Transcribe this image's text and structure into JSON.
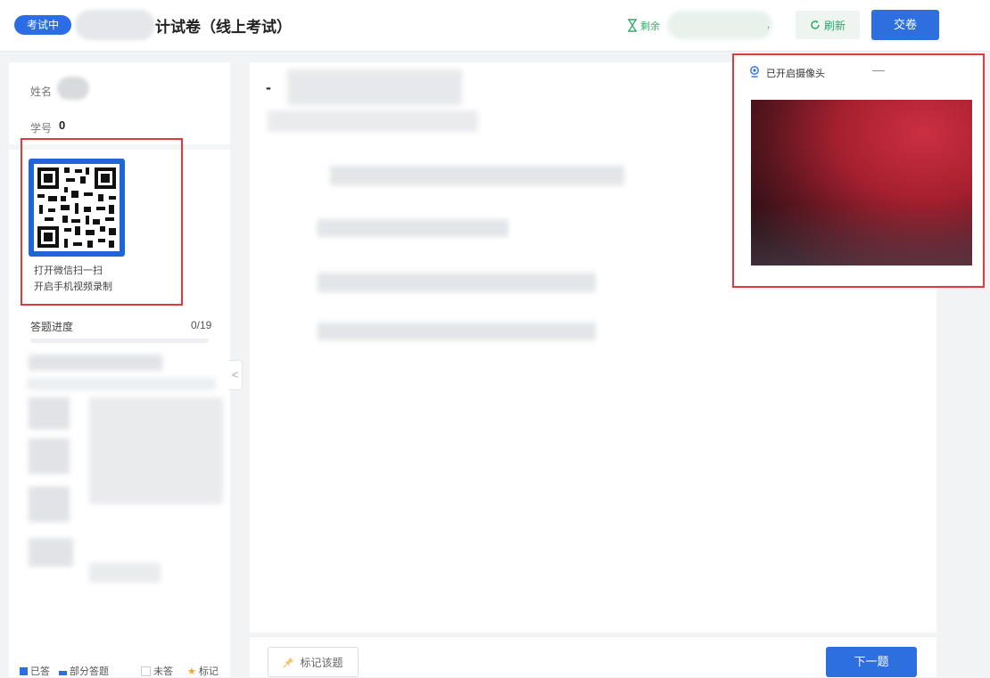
{
  "header": {
    "status_badge": "考试中",
    "exam_title": "计试卷（线上考试）",
    "remaining_label": "剩余",
    "remaining_suffix": ",",
    "refresh_label": "刷新",
    "submit_label": "交卷"
  },
  "student": {
    "name_label": "姓名",
    "id_label": "学号",
    "id_value": "0"
  },
  "qr": {
    "line1": "打开微信扫一扫",
    "line2": "开启手机视频录制"
  },
  "progress": {
    "label": "答题进度",
    "count": "0/19",
    "answered": 0,
    "total": 19
  },
  "legend": {
    "answered": "已答",
    "partial": "部分答题",
    "unanswered": "未答",
    "marked": "标记"
  },
  "question": {
    "dash": "-"
  },
  "camera": {
    "status_label": "已开启摄像头",
    "minimize_symbol": "—"
  },
  "footer": {
    "mark_label": "标记该题",
    "next_label": "下一题"
  },
  "colors": {
    "primary": "#2e6fe0",
    "success": "#2ea86b",
    "highlight_border": "#e13a3a",
    "mark_star": "#f2a33a"
  }
}
